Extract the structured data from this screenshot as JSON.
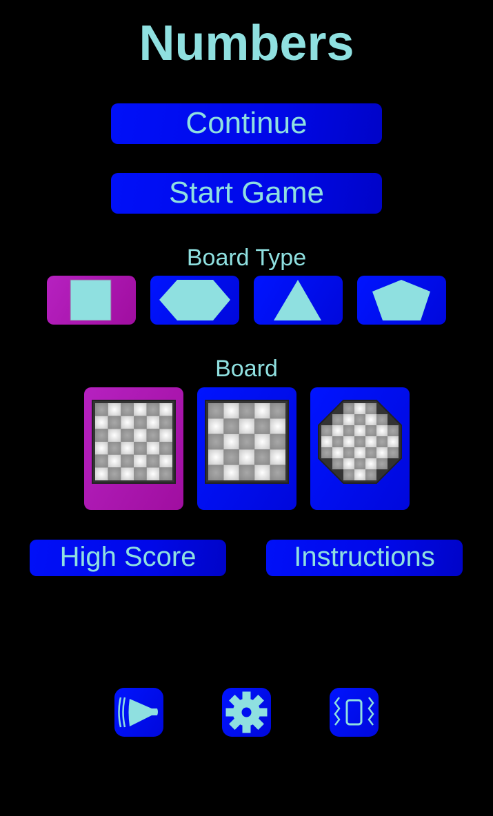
{
  "app": {
    "title": "Numbers"
  },
  "menu": {
    "continue_label": "Continue",
    "start_label": "Start Game",
    "high_score_label": "High Score",
    "instructions_label": "Instructions"
  },
  "board_type": {
    "label": "Board Type",
    "options": [
      {
        "name": "square",
        "icon": "square-icon",
        "selected": true
      },
      {
        "name": "hexagon",
        "icon": "hexagon-icon",
        "selected": false
      },
      {
        "name": "triangle",
        "icon": "triangle-icon",
        "selected": false
      },
      {
        "name": "pentagon",
        "icon": "pentagon-icon",
        "selected": false
      }
    ]
  },
  "board": {
    "label": "Board",
    "options": [
      {
        "name": "6x6",
        "cols": 6,
        "rows": 6,
        "shape": "square",
        "selected": true
      },
      {
        "name": "5x5",
        "cols": 5,
        "rows": 5,
        "shape": "square",
        "selected": false
      },
      {
        "name": "octagon-7",
        "cols": 7,
        "rows": 7,
        "row_lengths": [
          3,
          5,
          7,
          7,
          7,
          5,
          3
        ],
        "shape": "octagon",
        "selected": false
      }
    ]
  },
  "footer_icons": [
    {
      "name": "sound",
      "icon": "speaker-icon"
    },
    {
      "name": "settings",
      "icon": "gear-icon"
    },
    {
      "name": "vibration",
      "icon": "vibrate-icon"
    }
  ],
  "colors": {
    "accent_text": "#8fe0e0",
    "button_blue": "#0010f8",
    "selected_magenta": "#b01ab8",
    "background": "#000000"
  }
}
